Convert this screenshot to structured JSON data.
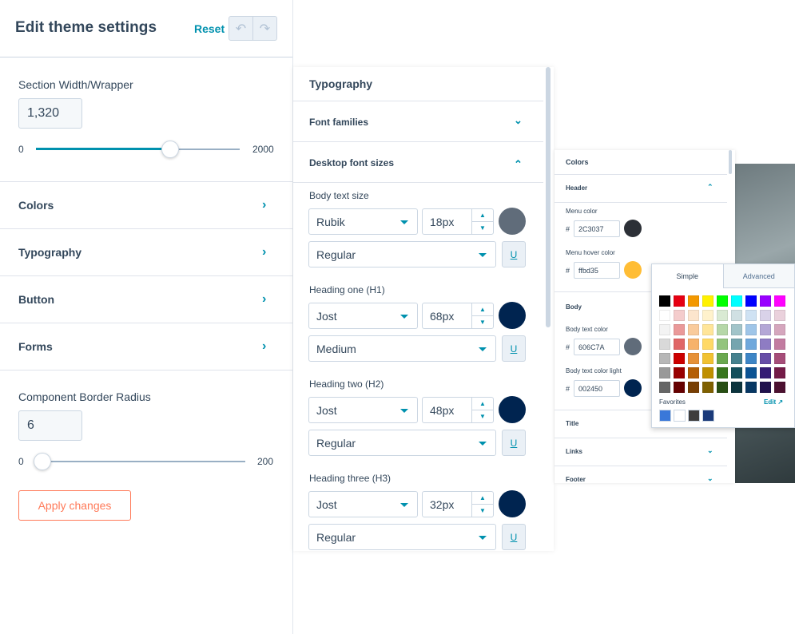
{
  "theme_panel": {
    "title": "Edit theme settings",
    "reset_label": "Reset",
    "section_width": {
      "label": "Section Width/Wrapper",
      "value": "1,320",
      "min": "0",
      "max": "2000",
      "fraction": 0.66
    },
    "sections": [
      "Colors",
      "Typography",
      "Button",
      "Forms"
    ],
    "border_radius": {
      "label": "Component Border Radius",
      "value": "6",
      "min": "0",
      "max": "200",
      "fraction": 0.0
    },
    "apply_label": "Apply changes"
  },
  "typography_panel": {
    "title": "Typography",
    "font_families_label": "Font families",
    "desktop_sizes_label": "Desktop font sizes",
    "items": [
      {
        "label": "Body text size",
        "font": "Rubik",
        "size": "18px",
        "weight": "Regular",
        "color": "#606c7a"
      },
      {
        "label": "Heading one (H1)",
        "font": "Jost",
        "size": "68px",
        "weight": "Medium",
        "color": "#002450"
      },
      {
        "label": "Heading two (H2)",
        "font": "Jost",
        "size": "48px",
        "weight": "Regular",
        "color": "#002450"
      },
      {
        "label": "Heading three (H3)",
        "font": "Jost",
        "size": "32px",
        "weight": "Regular",
        "color": "#002450"
      }
    ],
    "underline_label": "U"
  },
  "colors_panel": {
    "title": "Colors",
    "header_label": "Header",
    "menu_color_label": "Menu color",
    "menu_color_value": "2C3037",
    "menu_color": "#2c3037",
    "menu_hover_label": "Menu hover color",
    "menu_hover_value": "ffbd35",
    "menu_hover_color": "#ffbd35",
    "body_label": "Body",
    "body_text_label": "Body text color",
    "body_text_value": "606C7A",
    "body_text_color": "#606c7a",
    "body_text_light_label": "Body text color light",
    "body_text_light_value": "002450",
    "body_text_light_color": "#002450",
    "title_label": "Title",
    "links_label": "Links",
    "footer_label": "Footer",
    "hash": "#"
  },
  "color_picker": {
    "tab_simple": "Simple",
    "tab_advanced": "Advanced",
    "favorites_label": "Favorites",
    "edit_label": "Edit ↗",
    "swatches": [
      [
        "#000000",
        "#e60012",
        "#f39800",
        "#fff100",
        "#00ff00",
        "#00ffff",
        "#0000ff",
        "#9900ff",
        "#ff00ff"
      ],
      [
        "#ffffff",
        "#f4cccc",
        "#fce5cd",
        "#fff2cc",
        "#d9ead3",
        "#d0e0e3",
        "#cfe2f3",
        "#d9d2e9",
        "#ead1dc"
      ],
      [
        "#f3f3f3",
        "#ea9999",
        "#f9cb9c",
        "#ffe599",
        "#b6d7a8",
        "#a2c4c9",
        "#9fc5e8",
        "#b4a7d6",
        "#d5a6bd"
      ],
      [
        "#d9d9d9",
        "#e06666",
        "#f6b26b",
        "#ffd966",
        "#93c47d",
        "#76a5af",
        "#6fa8dc",
        "#8e7cc3",
        "#c27ba0"
      ],
      [
        "#b7b7b7",
        "#cc0000",
        "#e69138",
        "#f1c232",
        "#6aa84f",
        "#45818e",
        "#3d85c6",
        "#674ea7",
        "#a64d79"
      ],
      [
        "#999999",
        "#990000",
        "#b45f06",
        "#bf9000",
        "#38761d",
        "#134f5c",
        "#0b5394",
        "#351c75",
        "#741b47"
      ],
      [
        "#666666",
        "#660000",
        "#783f04",
        "#7f6000",
        "#274e13",
        "#0c343d",
        "#073763",
        "#20124d",
        "#4c1130"
      ]
    ],
    "favorites": [
      "#3a78d9",
      "#ffffff",
      "#3d3d3d",
      "#1b3a7a"
    ]
  }
}
